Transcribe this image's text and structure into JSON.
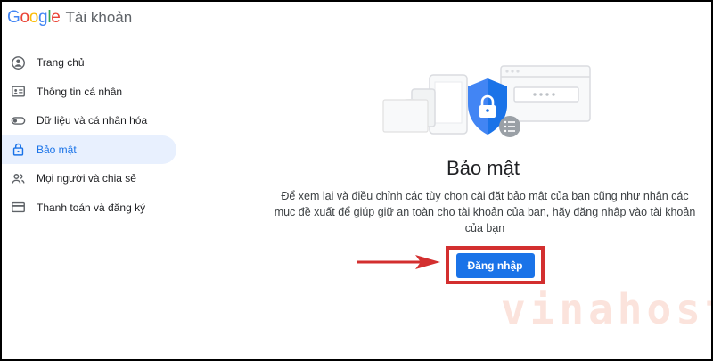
{
  "header": {
    "logo_letters": [
      {
        "ch": "G",
        "color": "#4285F4"
      },
      {
        "ch": "o",
        "color": "#EA4335"
      },
      {
        "ch": "o",
        "color": "#FBBC05"
      },
      {
        "ch": "g",
        "color": "#4285F4"
      },
      {
        "ch": "l",
        "color": "#34A853"
      },
      {
        "ch": "e",
        "color": "#EA4335"
      }
    ],
    "product": "Tài khoản"
  },
  "sidebar": {
    "items": [
      {
        "label": "Trang chủ",
        "icon": "account-circle-icon"
      },
      {
        "label": "Thông tin cá nhân",
        "icon": "id-card-icon"
      },
      {
        "label": "Dữ liệu và cá nhân hóa",
        "icon": "toggle-icon"
      },
      {
        "label": "Bảo mật",
        "icon": "lock-icon",
        "active": true
      },
      {
        "label": "Mọi người và chia sẻ",
        "icon": "people-icon"
      },
      {
        "label": "Thanh toán và đăng ký",
        "icon": "credit-card-icon"
      }
    ]
  },
  "main": {
    "title": "Bảo mật",
    "description": "Để xem lại và điều chỉnh các tùy chọn cài đặt bảo mật của bạn cũng như nhận các mục đề xuất để giúp giữ an toàn cho tài khoản của bạn, hãy đăng nhập vào tài khoản của bạn",
    "signin_label": "Đăng nhập"
  },
  "watermark": {
    "text": "vinahost"
  },
  "colors": {
    "accent": "#1a73e8",
    "active_bg": "#e8f0fe",
    "highlight": "#d32f2f",
    "watermark": "#fbe3dc"
  }
}
